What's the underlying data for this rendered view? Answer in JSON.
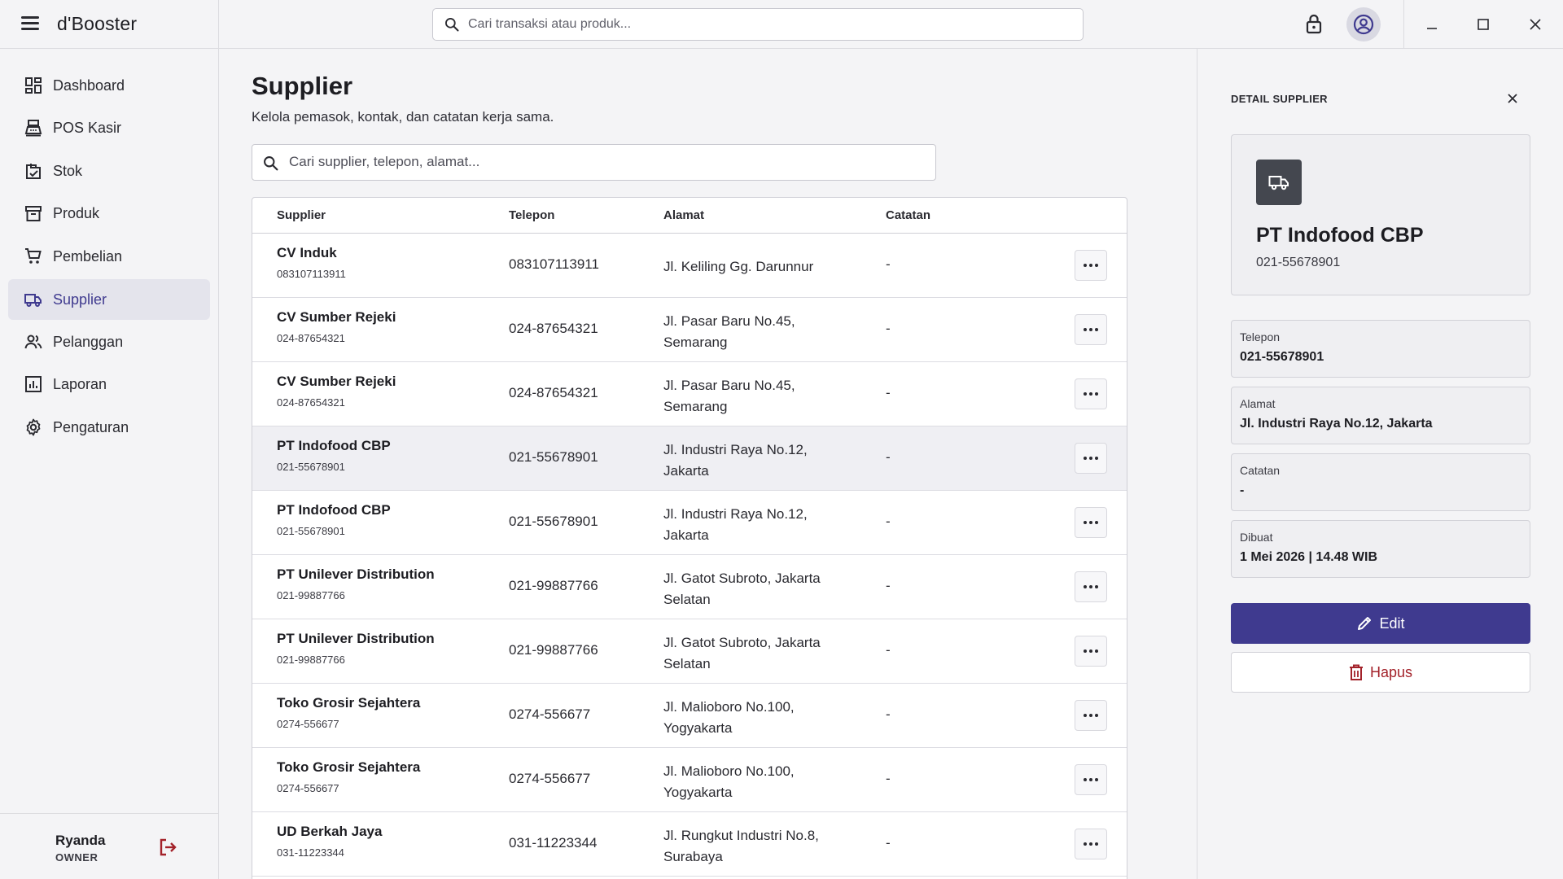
{
  "app": {
    "brand": "d'Booster"
  },
  "topbar": {
    "search_placeholder": "Cari transaksi atau produk...",
    "icons": [
      "menu-icon",
      "search-icon",
      "lock-icon",
      "account-circle-icon",
      "minimize-icon",
      "maximize-icon",
      "close-icon"
    ]
  },
  "sidebar": {
    "items": [
      {
        "label": "Dashboard",
        "icon": "dashboard-icon",
        "active": false
      },
      {
        "label": "POS Kasir",
        "icon": "cash-register-icon",
        "active": false
      },
      {
        "label": "Stok",
        "icon": "inventory-icon",
        "active": false
      },
      {
        "label": "Produk",
        "icon": "archive-box-icon",
        "active": false
      },
      {
        "label": "Pembelian",
        "icon": "cart-icon",
        "active": false
      },
      {
        "label": "Supplier",
        "icon": "truck-icon",
        "active": true
      },
      {
        "label": "Pelanggan",
        "icon": "people-icon",
        "active": false
      },
      {
        "label": "Laporan",
        "icon": "report-chart-icon",
        "active": false
      },
      {
        "label": "Pengaturan",
        "icon": "settings-gear-icon",
        "active": false
      }
    ],
    "user": {
      "name": "Ryanda",
      "role": "OWNER"
    }
  },
  "main": {
    "title": "Supplier",
    "subtitle": "Kelola pemasok, kontak, dan catatan kerja sama.",
    "search_placeholder": "Cari supplier, telepon, alamat...",
    "columns": [
      "Supplier",
      "Telepon",
      "Alamat",
      "Catatan"
    ],
    "rows": [
      {
        "name": "CV Induk",
        "sub": "083107113911",
        "phone": "083107113911",
        "address": "Jl. Keliling Gg. Darunnur",
        "note": "-",
        "selected": false
      },
      {
        "name": "CV Sumber Rejeki",
        "sub": "024-87654321",
        "phone": "024-87654321",
        "address": "Jl. Pasar Baru No.45, Semarang",
        "note": "-",
        "selected": false
      },
      {
        "name": "CV Sumber Rejeki",
        "sub": "024-87654321",
        "phone": "024-87654321",
        "address": "Jl. Pasar Baru No.45, Semarang",
        "note": "-",
        "selected": false
      },
      {
        "name": "PT Indofood CBP",
        "sub": "021-55678901",
        "phone": "021-55678901",
        "address": "Jl. Industri Raya No.12, Jakarta",
        "note": "-",
        "selected": true
      },
      {
        "name": "PT Indofood CBP",
        "sub": "021-55678901",
        "phone": "021-55678901",
        "address": "Jl. Industri Raya No.12, Jakarta",
        "note": "-",
        "selected": false
      },
      {
        "name": "PT Unilever Distribution",
        "sub": "021-99887766",
        "phone": "021-99887766",
        "address": "Jl. Gatot Subroto, Jakarta Selatan",
        "note": "-",
        "selected": false
      },
      {
        "name": "PT Unilever Distribution",
        "sub": "021-99887766",
        "phone": "021-99887766",
        "address": "Jl. Gatot Subroto, Jakarta Selatan",
        "note": "-",
        "selected": false
      },
      {
        "name": "Toko Grosir Sejahtera",
        "sub": "0274-556677",
        "phone": "0274-556677",
        "address": "Jl. Malioboro No.100, Yogyakarta",
        "note": "-",
        "selected": false
      },
      {
        "name": "Toko Grosir Sejahtera",
        "sub": "0274-556677",
        "phone": "0274-556677",
        "address": "Jl. Malioboro No.100, Yogyakarta",
        "note": "-",
        "selected": false
      },
      {
        "name": "UD Berkah Jaya",
        "sub": "031-11223344",
        "phone": "031-11223344",
        "address": "Jl. Rungkut Industri No.8, Surabaya",
        "note": "-",
        "selected": false
      }
    ]
  },
  "detail": {
    "heading": "DETAIL SUPPLIER",
    "name": "PT Indofood CBP",
    "phone_sub": "021-55678901",
    "fields": [
      {
        "label": "Telepon",
        "value": "021-55678901"
      },
      {
        "label": "Alamat",
        "value": "Jl. Industri Raya No.12, Jakarta"
      },
      {
        "label": "Catatan",
        "value": "-"
      },
      {
        "label": "Dibuat",
        "value": "1 Mei 2026 | 14.48 WIB"
      }
    ],
    "edit_label": "Edit",
    "delete_label": "Hapus"
  },
  "colors": {
    "accent": "#3f3a8f",
    "danger": "#a3222a",
    "selected_row": "#efeff3"
  }
}
